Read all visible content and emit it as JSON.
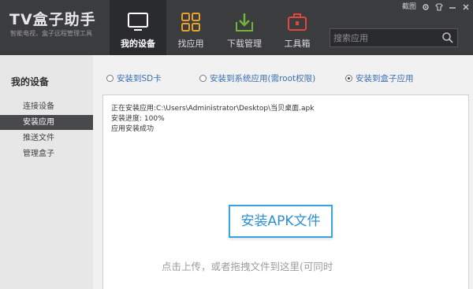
{
  "app": {
    "title": "TV盒子助手",
    "subtitle": "智能电视，盒子远程管理工具"
  },
  "window_controls": {
    "screenshot_label": "截图"
  },
  "nav": {
    "items": [
      {
        "label": "我的设备",
        "icon": "monitor-icon",
        "active": true
      },
      {
        "label": "找应用",
        "icon": "grid-icon",
        "active": false
      },
      {
        "label": "下载管理",
        "icon": "download-icon",
        "active": false
      },
      {
        "label": "工具箱",
        "icon": "toolbox-icon",
        "active": false
      }
    ]
  },
  "search": {
    "placeholder": "搜索应用"
  },
  "sidebar": {
    "title": "我的设备",
    "items": [
      {
        "label": "连接设备",
        "selected": false
      },
      {
        "label": "安装应用",
        "selected": true
      },
      {
        "label": "推送文件",
        "selected": false
      },
      {
        "label": "管理盒子",
        "selected": false
      }
    ]
  },
  "install_targets": {
    "options": [
      {
        "label": "安装到SD卡",
        "checked": false
      },
      {
        "label": "安装到系统应用(需root权限)",
        "checked": false
      },
      {
        "label": "安装到盒子应用",
        "checked": true
      }
    ]
  },
  "log": {
    "lines": [
      "正在安装应用:C:\\Users\\Administrator\\Desktop\\当贝桌面.apk",
      "安装进度:  100%",
      "应用安装成功"
    ]
  },
  "install": {
    "button_label": "安装APK文件",
    "hint": "点击上传，或者拖拽文件到这里(可同时"
  },
  "colors": {
    "header_bg": "#3b3c3e",
    "accent_blue": "#2d8fd4",
    "icon_orange": "#e8a12c",
    "icon_green": "#6fb43b",
    "icon_red": "#e0483c"
  }
}
